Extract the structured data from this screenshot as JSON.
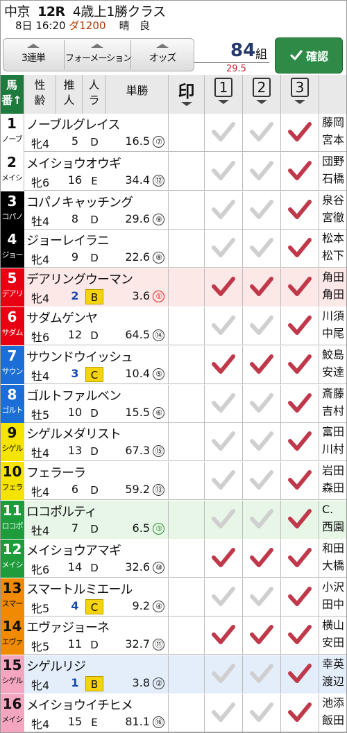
{
  "race": {
    "venue": "中京",
    "race_no": "12R",
    "race_class": "4歳上1勝クラス",
    "date": "8日",
    "time": "16:20",
    "course": "ダ1200",
    "weather": "晴",
    "going": "良"
  },
  "toolbar": {
    "bet_type": "3連単",
    "formation": "フォーメーション",
    "odds": "オッズ",
    "combo_count": "84",
    "combo_unit": "組",
    "combo_sub": "29.5",
    "confirm_label": "確認"
  },
  "columns": {
    "umaban": [
      "馬",
      "番"
    ],
    "sex_age": [
      "性",
      "齢"
    ],
    "recommend": [
      "推",
      "人"
    ],
    "rank": [
      "人",
      "ラ"
    ],
    "win_odds": "単勝",
    "mark": "印",
    "pick1": "1",
    "pick2": "2",
    "pick3": "3"
  },
  "colors": {
    "accent_green": "#1f7a3e",
    "check_on": "#c0394b",
    "check_off": "#cfcfcf",
    "waku": [
      "#ffffff",
      "#000000",
      "#e60012",
      "#1b6ed6",
      "#f5e400",
      "#1e9b3b",
      "#f08a00",
      "#f4a6c0"
    ]
  },
  "horses": [
    {
      "no": "1",
      "abbr": "ノーブ",
      "name": "ノーブルグレイス",
      "sex_age": "牝4",
      "rec": "5",
      "rank": "D",
      "odds": "16.5",
      "pop": "7",
      "jockey": [
        "藤岡",
        "宮本"
      ],
      "picks": [
        false,
        false,
        true
      ],
      "waku": 1
    },
    {
      "no": "2",
      "abbr": "メイシ",
      "name": "メイショウオウギ",
      "sex_age": "牝6",
      "rec": "16",
      "rank": "E",
      "odds": "34.4",
      "pop": "12",
      "jockey": [
        "団野",
        "石橋"
      ],
      "picks": [
        false,
        false,
        true
      ],
      "waku": 1
    },
    {
      "no": "3",
      "abbr": "コパノ",
      "name": "コパノキャッチング",
      "sex_age": "牡4",
      "rec": "8",
      "rank": "D",
      "odds": "29.6",
      "pop": "9",
      "jockey": [
        "泉谷",
        "宮徹"
      ],
      "picks": [
        false,
        false,
        true
      ],
      "waku": 2
    },
    {
      "no": "4",
      "abbr": "ジョー",
      "name": "ジョーレイラニ",
      "sex_age": "牝4",
      "rec": "9",
      "rank": "D",
      "odds": "22.6",
      "pop": "8",
      "jockey": [
        "松本",
        "松下"
      ],
      "picks": [
        false,
        false,
        true
      ],
      "waku": 2
    },
    {
      "no": "5",
      "abbr": "デアリ",
      "name": "デアリングウーマン",
      "sex_age": "牝4",
      "rec": "2",
      "rank": "B",
      "odds": "3.6",
      "pop": "1",
      "jockey": [
        "角田",
        "角田"
      ],
      "picks": [
        true,
        true,
        true
      ],
      "waku": 3
    },
    {
      "no": "6",
      "abbr": "サダム",
      "name": "サダムゲンヤ",
      "sex_age": "牡6",
      "rec": "12",
      "rank": "D",
      "odds": "64.5",
      "pop": "14",
      "jockey": [
        "川須",
        "中尾"
      ],
      "picks": [
        false,
        false,
        true
      ],
      "waku": 3
    },
    {
      "no": "7",
      "abbr": "サウン",
      "name": "サウンドウイッシュ",
      "sex_age": "牡4",
      "rec": "3",
      "rank": "C",
      "odds": "10.4",
      "pop": "5",
      "jockey": [
        "鮫島",
        "安達"
      ],
      "picks": [
        true,
        true,
        true
      ],
      "waku": 4
    },
    {
      "no": "8",
      "abbr": "ゴルト",
      "name": "ゴルトファルベン",
      "sex_age": "牡5",
      "rec": "10",
      "rank": "D",
      "odds": "15.5",
      "pop": "6",
      "jockey": [
        "斎藤",
        "吉村"
      ],
      "picks": [
        false,
        false,
        true
      ],
      "waku": 4
    },
    {
      "no": "9",
      "abbr": "シゲル",
      "name": "シゲルメダリスト",
      "sex_age": "牡4",
      "rec": "13",
      "rank": "D",
      "odds": "67.3",
      "pop": "15",
      "jockey": [
        "富田",
        "川村"
      ],
      "picks": [
        false,
        false,
        true
      ],
      "waku": 5
    },
    {
      "no": "10",
      "abbr": "フェラ",
      "name": "フェラーラ",
      "sex_age": "牝4",
      "rec": "6",
      "rank": "D",
      "odds": "59.2",
      "pop": "13",
      "jockey": [
        "岩田",
        "森田"
      ],
      "picks": [
        false,
        false,
        true
      ],
      "waku": 5
    },
    {
      "no": "11",
      "abbr": "ロコポ",
      "name": "ロコポルティ",
      "sex_age": "牡4",
      "rec": "7",
      "rank": "D",
      "odds": "6.5",
      "pop": "3",
      "jockey": [
        "C.",
        "西園"
      ],
      "picks": [
        false,
        false,
        true
      ],
      "waku": 6
    },
    {
      "no": "12",
      "abbr": "メイシ",
      "name": "メイショウアマギ",
      "sex_age": "牝6",
      "rec": "14",
      "rank": "D",
      "odds": "32.6",
      "pop": "10",
      "jockey": [
        "和田",
        "大橋"
      ],
      "picks": [
        true,
        true,
        true
      ],
      "waku": 6
    },
    {
      "no": "13",
      "abbr": "スマー",
      "name": "スマートルミエール",
      "sex_age": "牝5",
      "rec": "4",
      "rank": "C",
      "odds": "9.2",
      "pop": "4",
      "jockey": [
        "小沢",
        "田中"
      ],
      "picks": [
        false,
        false,
        true
      ],
      "waku": 7
    },
    {
      "no": "14",
      "abbr": "エヴァ",
      "name": "エヴァジョーネ",
      "sex_age": "牝5",
      "rec": "11",
      "rank": "D",
      "odds": "32.7",
      "pop": "11",
      "jockey": [
        "横山",
        "安田"
      ],
      "picks": [
        true,
        true,
        true
      ],
      "waku": 7
    },
    {
      "no": "15",
      "abbr": "シゲル",
      "name": "シゲルリジ",
      "sex_age": "牝4",
      "rec": "1",
      "rank": "B",
      "odds": "3.8",
      "pop": "2",
      "jockey": [
        "幸英",
        "渡辺"
      ],
      "picks": [
        false,
        false,
        true
      ],
      "waku": 8
    },
    {
      "no": "16",
      "abbr": "メイシ",
      "name": "メイショウイチヒメ",
      "sex_age": "牝4",
      "rec": "15",
      "rank": "E",
      "odds": "81.1",
      "pop": "16",
      "jockey": [
        "池添",
        "飯田"
      ],
      "picks": [
        false,
        false,
        true
      ],
      "waku": 8
    }
  ],
  "row_tints": {
    "5": "pink",
    "11": "mint",
    "15": "sky"
  }
}
